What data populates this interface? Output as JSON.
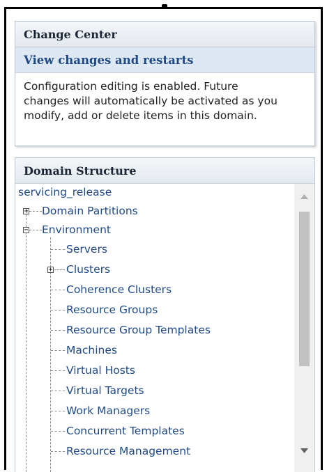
{
  "change_center": {
    "title": "Change Center",
    "link": "View changes and restarts",
    "message_lines": [
      "Configuration editing is enabled. Future",
      "changes will automatically be activated as you",
      "modify, add or delete items in this domain."
    ]
  },
  "domain_structure": {
    "title": "Domain Structure",
    "root": "servicing_release",
    "items": [
      {
        "label": "Domain Partitions",
        "expander": "+"
      },
      {
        "label": "Environment",
        "expander": "−"
      },
      {
        "label": "Servers"
      },
      {
        "label": "Clusters",
        "expander": "+"
      },
      {
        "label": "Coherence Clusters"
      },
      {
        "label": "Resource Groups"
      },
      {
        "label": "Resource Group Templates"
      },
      {
        "label": "Machines"
      },
      {
        "label": "Virtual Hosts"
      },
      {
        "label": "Virtual Targets"
      },
      {
        "label": "Work Managers"
      },
      {
        "label": "Concurrent Templates"
      },
      {
        "label": "Resource Management"
      }
    ]
  },
  "icons": {
    "expand": "plus-box-icon",
    "collapse": "minus-box-icon",
    "scroll_up": "scroll-up-arrow-icon",
    "scroll_down": "scroll-down-arrow-icon"
  },
  "colors": {
    "link": "#1f4a86",
    "header_bg": "#e3e9ef",
    "link_row_bg": "#dde8f2"
  }
}
